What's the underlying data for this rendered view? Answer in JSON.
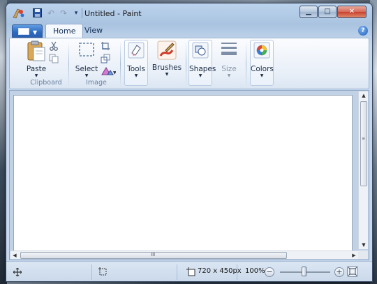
{
  "window": {
    "title": "Untitled - Paint",
    "controls": {
      "minimize": "▁",
      "maximize": "□",
      "close": "✕"
    }
  },
  "quick_access": [
    {
      "name": "save-icon",
      "glyph": "💾"
    },
    {
      "name": "undo-icon",
      "glyph": "↶"
    },
    {
      "name": "redo-icon",
      "glyph": "↷"
    },
    {
      "name": "customize-icon",
      "glyph": "▾"
    }
  ],
  "tabs": [
    {
      "label": "Home",
      "active": true
    },
    {
      "label": "View",
      "active": false
    }
  ],
  "help": "?",
  "ribbon": {
    "clipboard": {
      "group_label": "Clipboard",
      "paste_label": "Paste"
    },
    "image": {
      "group_label": "Image",
      "select_label": "Select"
    },
    "tools_label": "Tools",
    "brushes_label": "Brushes",
    "shapes_label": "Shapes",
    "size_label": "Size",
    "colors_label": "Colors"
  },
  "canvas": {
    "vscroll_grip": "≡",
    "hscroll_grip": "III"
  },
  "status": {
    "image_size": "720 x 450px",
    "zoom": "100%",
    "zoom_level": 1.0
  },
  "colors": {
    "accent": "#2e6ac0",
    "ribbon": "#e8eff8",
    "canvas_bg": "#c2d2e6"
  }
}
